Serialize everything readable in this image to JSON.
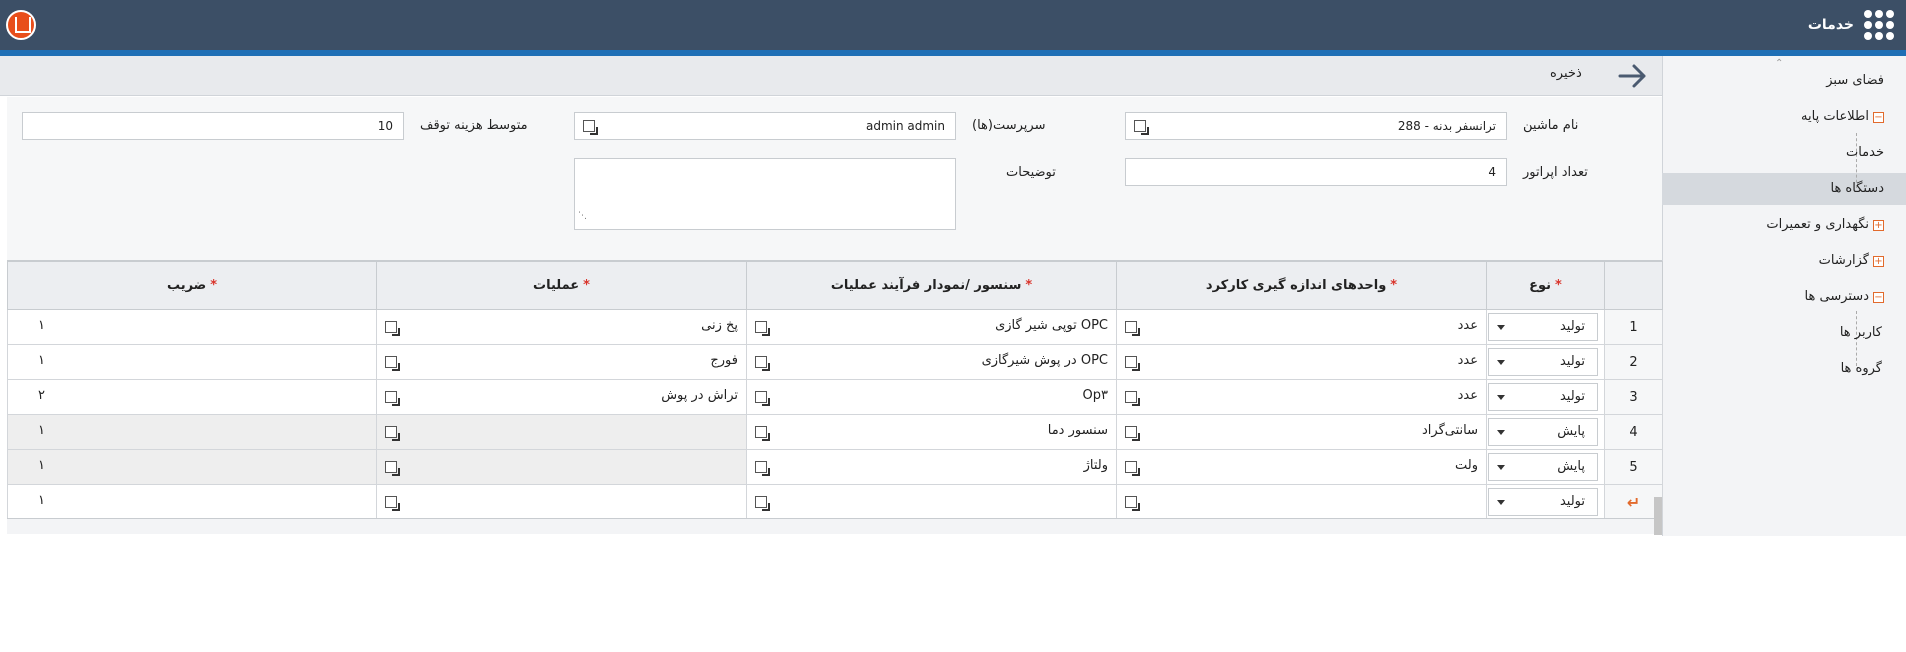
{
  "header": {
    "apps_label": "خدمات",
    "logo": "app-logo",
    "apps_icon": "grid-dots-icon"
  },
  "toolbar": {
    "save_label": "ذخیره",
    "back_icon": "arrow-right-icon"
  },
  "sidebar": {
    "items": [
      {
        "label": "فضای سبز",
        "level": 0,
        "toggle": ""
      },
      {
        "label": "اطلاعات پایه",
        "level": 0,
        "toggle": "−"
      },
      {
        "label": "خدمات",
        "level": 1,
        "toggle": ""
      },
      {
        "label": "دستگاه ها",
        "level": 1,
        "toggle": "",
        "selected": true
      },
      {
        "label": "نگهداری و تعمیرات",
        "level": 0,
        "toggle": "+"
      },
      {
        "label": "گزارشات",
        "level": 0,
        "toggle": "+"
      },
      {
        "label": "دسترسی ها",
        "level": 0,
        "toggle": "−"
      },
      {
        "label": "کاربر ها",
        "level": 1,
        "toggle": ""
      },
      {
        "label": "گروه ها",
        "level": 1,
        "toggle": ""
      }
    ]
  },
  "form": {
    "machine_name_label": "نام ماشین",
    "machine_name_value": "ترانسفر بدنه - 288",
    "supervisor_label": "سرپرست(ها)",
    "supervisor_value": "admin admin",
    "avg_cost_label": "متوسط هزینه توقف",
    "avg_cost_value": "10",
    "operators_label": "تعداد اپراتور",
    "operators_value": "4",
    "description_label": "توضیحات",
    "description_value": ""
  },
  "grid": {
    "columns": [
      {
        "label": "نوع",
        "required": true
      },
      {
        "label": "واحدهای اندازه گیری کارکرد",
        "required": true
      },
      {
        "label": "سنسور /نمودار فرآیند عملیات",
        "required": true
      },
      {
        "label": "عملیات",
        "required": true
      },
      {
        "label": "ضریب",
        "required": true
      }
    ],
    "required_mark": "*",
    "rows": [
      {
        "num": "1",
        "type": "تولید",
        "unit": "عدد",
        "sensor": "OPC توپی شیر گازی",
        "operation": "پخ زنی",
        "factor": "۱",
        "gray": false
      },
      {
        "num": "2",
        "type": "تولید",
        "unit": "عدد",
        "sensor": "OPC در پوش شیرگازی",
        "operation": "فورج",
        "factor": "۱",
        "gray": false
      },
      {
        "num": "3",
        "type": "تولید",
        "unit": "عدد",
        "sensor": "Op۳",
        "operation": "تراش در پوش",
        "factor": "۲",
        "gray": false
      },
      {
        "num": "4",
        "type": "پایش",
        "unit": "سانتی‌گراد",
        "sensor": "سنسور دما",
        "operation": "",
        "factor": "۱",
        "gray": true
      },
      {
        "num": "5",
        "type": "پایش",
        "unit": "ولت",
        "sensor": "ولتاژ",
        "operation": "",
        "factor": "۱",
        "gray": true
      },
      {
        "num": "↵",
        "type": "تولید",
        "unit": "",
        "sensor": "",
        "operation": "",
        "factor": "۱",
        "gray": false,
        "new_row": true
      }
    ]
  }
}
